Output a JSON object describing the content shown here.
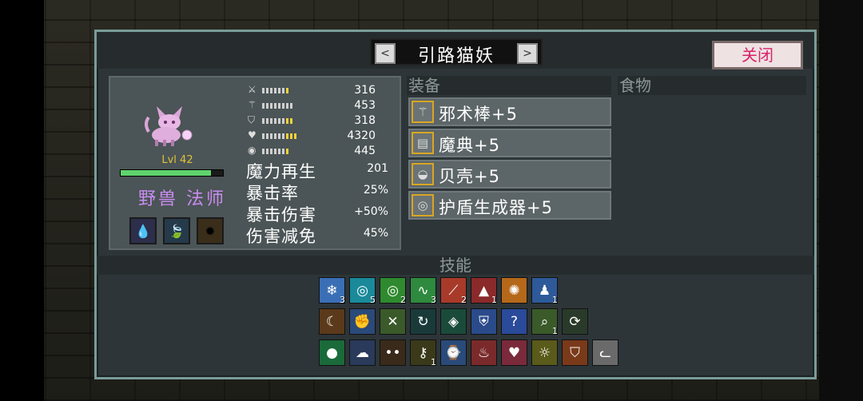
{
  "header": {
    "title": "引路猫妖",
    "prev_arrow": "<",
    "next_arrow": ">",
    "close_label": "关闭"
  },
  "pet": {
    "level_text": "Lvl 42",
    "xp_progress": 0.88,
    "class_text": "野兽 法师",
    "traits": [
      {
        "icon": "water-up-icon",
        "glyph": "💧",
        "color": "#2c2e4a"
      },
      {
        "icon": "leaf-shield-icon",
        "glyph": "🍃",
        "color": "#253a4a"
      },
      {
        "icon": "sun-sparkle-icon",
        "glyph": "✹",
        "color": "#3a2e1a"
      }
    ]
  },
  "stats": [
    {
      "icon": "sword-icon",
      "glyph": "⚔",
      "value": "316",
      "pips_white": 6,
      "pips_yellow": 1
    },
    {
      "icon": "staff-icon",
      "glyph": "⚚",
      "value": "453",
      "pips_white": 8,
      "pips_yellow": 0
    },
    {
      "icon": "shield-icon",
      "glyph": "⛉",
      "value": "318",
      "pips_white": 6,
      "pips_yellow": 2
    },
    {
      "icon": "heart-icon",
      "glyph": "♥",
      "value": "4320",
      "pips_white": 6,
      "pips_yellow": 3
    },
    {
      "icon": "boot-icon",
      "glyph": "◉",
      "value": "445",
      "pips_white": 6,
      "pips_yellow": 1
    }
  ],
  "secondary_stats": [
    {
      "label": "魔力再生",
      "value": "201"
    },
    {
      "label": "暴击率",
      "value": "25%"
    },
    {
      "label": "暴击伤害",
      "value": "+50%"
    },
    {
      "label": "伤害减免",
      "value": "45%"
    }
  ],
  "equipment": {
    "header": "装备",
    "items": [
      {
        "icon": "wand-icon",
        "glyph": "⚚",
        "label": "邪术棒+5"
      },
      {
        "icon": "tome-icon",
        "glyph": "▤",
        "label": "魔典+5"
      },
      {
        "icon": "shell-icon",
        "glyph": "◒",
        "label": "贝壳+5"
      },
      {
        "icon": "shield-generator-icon",
        "glyph": "◎",
        "label": "护盾生成器+5"
      }
    ]
  },
  "food": {
    "header": "食物"
  },
  "skills": {
    "header": "技能",
    "rows": [
      [
        {
          "icon": "ice-storm-icon",
          "glyph": "❄",
          "color": "#3a6fb5",
          "count": "3"
        },
        {
          "icon": "cyan-ring-icon",
          "glyph": "◎",
          "color": "#1a8a9a",
          "count": "5"
        },
        {
          "icon": "green-ring-icon",
          "glyph": "◎",
          "color": "#2f8a2f",
          "count": "2"
        },
        {
          "icon": "lightning-icon",
          "glyph": "∿",
          "color": "#2e8a3e",
          "count": "3"
        },
        {
          "icon": "claw-slash-icon",
          "glyph": "⟋",
          "color": "#a83a2a",
          "count": "2"
        },
        {
          "icon": "teeth-icon",
          "glyph": "▲",
          "color": "#8a2a2a",
          "count": "1"
        },
        {
          "icon": "fire-burst-icon",
          "glyph": "✺",
          "color": "#b5681a",
          "count": ""
        },
        {
          "icon": "mage-robe-icon",
          "glyph": "♟",
          "color": "#2e5a9a",
          "count": "1"
        }
      ],
      [
        {
          "icon": "moon-icon",
          "glyph": "☾",
          "color": "#5a3a1a",
          "count": ""
        },
        {
          "icon": "fist-icon",
          "glyph": "✊",
          "color": "#2a4a7a",
          "count": ""
        },
        {
          "icon": "strike-icon",
          "glyph": "✕",
          "color": "#3a5a2a",
          "count": ""
        },
        {
          "icon": "cycle-icon",
          "glyph": "↻",
          "color": "#1a3a3a",
          "count": ""
        },
        {
          "icon": "diamond-icon",
          "glyph": "◈",
          "color": "#1a4a3a",
          "count": ""
        },
        {
          "icon": "heart-shield-icon",
          "glyph": "⛨",
          "color": "#2a4a8a",
          "count": ""
        },
        {
          "icon": "mystery-icon",
          "glyph": "?",
          "color": "#2a4a9a",
          "count": ""
        },
        {
          "icon": "magnify-icon",
          "glyph": "⌕",
          "color": "#3a5a2a",
          "count": "1"
        },
        {
          "icon": "swirl-icon",
          "glyph": "⟳",
          "color": "#2a3a2a",
          "count": ""
        }
      ],
      [
        {
          "icon": "green-orb-icon",
          "glyph": "●",
          "color": "#1a6a3a",
          "count": ""
        },
        {
          "icon": "cloud-icon",
          "glyph": "☁",
          "color": "#2a3a5a",
          "count": ""
        },
        {
          "icon": "eyes-icon",
          "glyph": "••",
          "color": "#3a2a1a",
          "count": ""
        },
        {
          "icon": "key-icon",
          "glyph": "⚷",
          "color": "#3a3a1a",
          "count": "1"
        },
        {
          "icon": "clock-shield-icon",
          "glyph": "⌚",
          "color": "#2a4a7a",
          "count": ""
        },
        {
          "icon": "berserk-icon",
          "glyph": "♨",
          "color": "#7a2a2a",
          "count": ""
        },
        {
          "icon": "heart-glow-icon",
          "glyph": "♥",
          "color": "#7a2a3a",
          "count": ""
        },
        {
          "icon": "light-bulb-icon",
          "glyph": "☼",
          "color": "#5a5a1a",
          "count": ""
        },
        {
          "icon": "fire-shield-icon",
          "glyph": "⛉",
          "color": "#7a3a1a",
          "count": ""
        },
        {
          "icon": "cat-face-icon",
          "glyph": "ᓚ",
          "color": "#6a6a6a",
          "count": ""
        }
      ]
    ]
  }
}
